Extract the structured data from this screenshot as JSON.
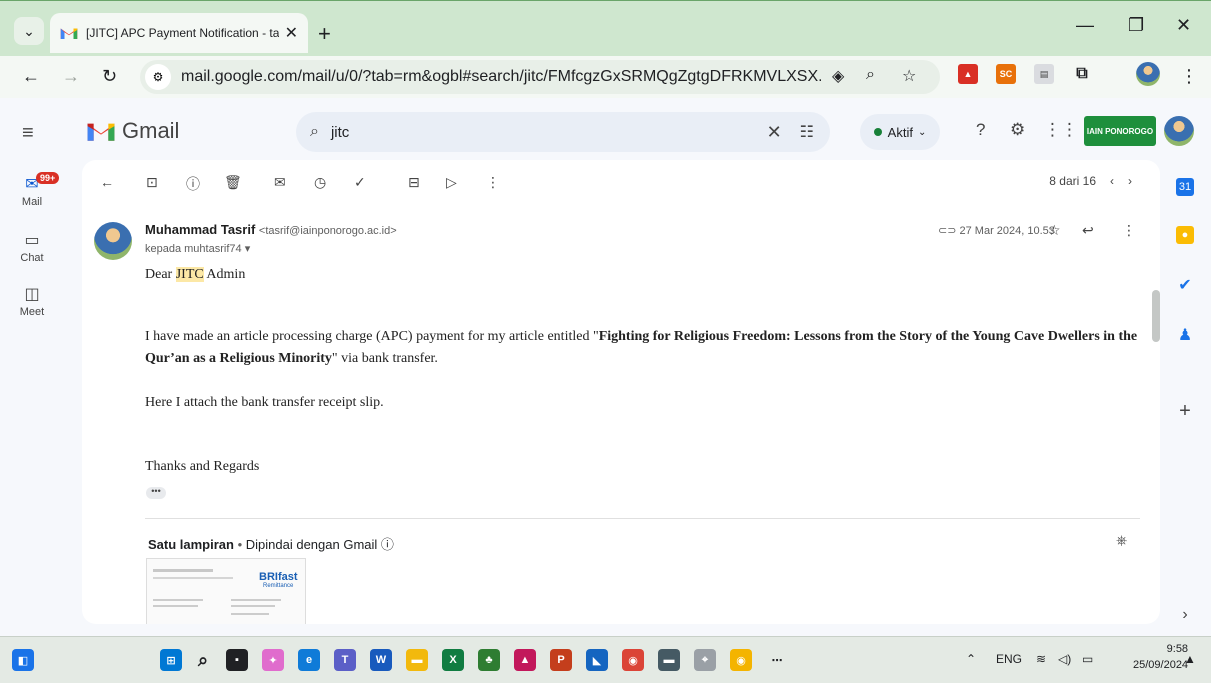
{
  "browser": {
    "tab_title": "[JITC] APC Payment Notification - tasr",
    "url": "mail.google.com/mail/u/0/?tab=rm&ogbl#search/jitc/FMfcgzGxSRMQgZgtgDFRKMVLXSX...",
    "ext_sc": "SC"
  },
  "gmail": {
    "brand": "Gmail",
    "search_value": "jitc",
    "status": "Aktif",
    "org_logo_text": "IAIN PONOROGO"
  },
  "rail": {
    "badge": "99+",
    "items": [
      {
        "label": "Mail"
      },
      {
        "label": "Chat"
      },
      {
        "label": "Meet"
      }
    ]
  },
  "toolbar": {
    "pager": "8 dari 16"
  },
  "message": {
    "sender_name": "Muhammad Tasrif",
    "sender_email": "<tasrif@iainponorogo.ac.id>",
    "to": "kepada muhtasrif74",
    "date": "27 Mar 2024, 10.53",
    "greeting_pre": "Dear ",
    "greeting_hl": "JITC",
    "greeting_post": " Admin",
    "p1_pre": "I have made an article processing charge (APC) payment for my article entitled  \"",
    "p1_bold": "Fighting for Religious Freedom: Lessons from the Story of the Young Cave Dwellers in the Qur’an as a Religious Minority",
    "p1_post": "\" via bank transfer.",
    "p2": "Here I attach the bank transfer receipt slip.",
    "p3": "Thanks and Regards",
    "more": "•••"
  },
  "attachment": {
    "title": "Satu lampiran",
    "scanned": "Dipindai dengan Gmail",
    "thumb_brand": "BRIfast",
    "thumb_sub": "Remittance"
  },
  "taskbar": {
    "lang": "ENG",
    "time": "9:58",
    "date": "25/09/2024"
  }
}
